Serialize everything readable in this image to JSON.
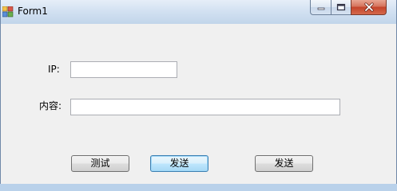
{
  "window": {
    "title": "Form1",
    "minimize_icon": "minimize-icon",
    "maximize_icon": "maximize-icon",
    "close_icon": "close-icon",
    "app_icon": "form-app-icon"
  },
  "form": {
    "ip_label": "IP:",
    "ip_value": "",
    "content_label": "内容:",
    "content_value": ""
  },
  "buttons": {
    "test_label": "测试",
    "send1_label": "发送",
    "send2_label": "发送"
  },
  "colors": {
    "close_button": "#c4432a",
    "focus_border": "#3c7fb1"
  }
}
